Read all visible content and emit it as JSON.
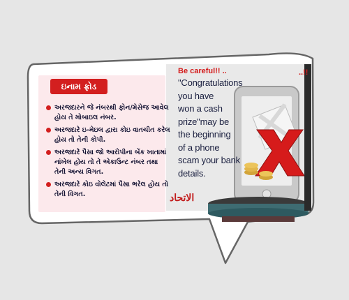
{
  "panel": {
    "title": "ઇનામ ફ્રોડ",
    "items": [
      "અરજદારને જે નંબરથી ફોન/મેસેજ આવેલ હોય તે મોબાઇલ નંબર.",
      "અરજદારે ઇ-મેઇલ દ્વારા કોઇ વાતચીત કરેલ હોય તો તેની કોપી.",
      "અરજદારે પૈસા જો આરોપીના બેંક ખાતામાં નાંખેલ હોય તો તે એકાઉન્ટ નંબર તથા તેની અન્ય વિગત.",
      "અરજદારે કોઇ વોલેટમાં પૈસા ભરેલ હોય તો તેની વિગત."
    ]
  },
  "scene": {
    "heading": "Be careful!! ..",
    "corner_mark": "..!!",
    "message": "\"Congratulations\nyou have\nwon a cash\nprize\"may be\nthe beginning\nof a phone\nscam your bank\ndetails.",
    "logo_text": "الاتحاد"
  },
  "colors": {
    "accent_red": "#d31f1f",
    "text_dark": "#101030",
    "bubble_border": "#666666",
    "panel_bg": "#fce9ec",
    "phone_bg": "#c9c9c9"
  }
}
